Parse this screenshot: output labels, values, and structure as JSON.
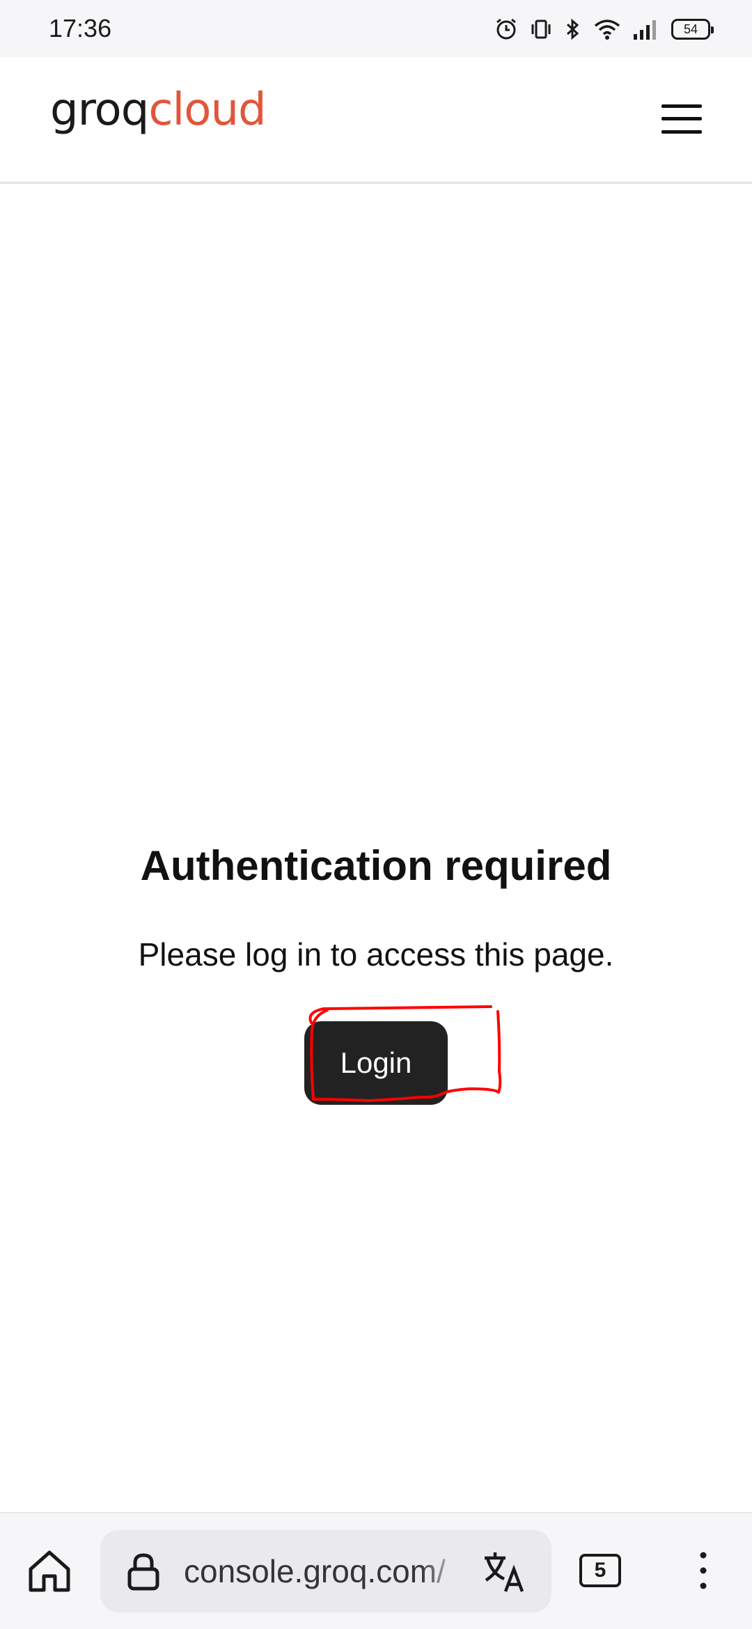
{
  "status_bar": {
    "time": "17:36",
    "battery_level": "54",
    "icons": [
      "alarm-icon",
      "vibrate-icon",
      "bluetooth-icon",
      "wifi-icon",
      "signal-icon",
      "battery-icon"
    ]
  },
  "header": {
    "logo_part1": "groq",
    "logo_part2": "cloud",
    "brand_color": "#e2553a",
    "menu_icon": "hamburger-menu-icon"
  },
  "main": {
    "title": "Authentication required",
    "message": "Please log in to access this page.",
    "login_label": "Login",
    "annotation_color": "#ff0000"
  },
  "browser_bar": {
    "url": "console.groq.com/",
    "tab_count": "5",
    "icons": [
      "home-icon",
      "lock-icon",
      "translate-icon",
      "tabs-icon",
      "more-options-icon"
    ]
  }
}
